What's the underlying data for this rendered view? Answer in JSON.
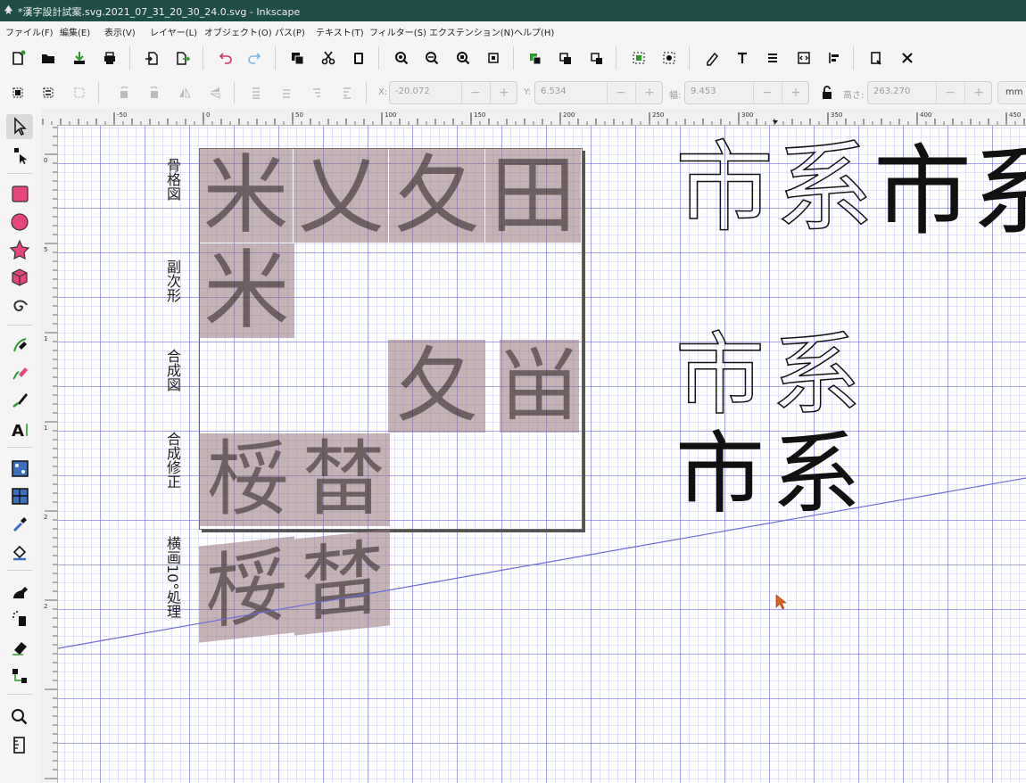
{
  "window": {
    "title": "*漢字設計試案.svg.2021_07_31_20_30_24.0.svg - Inkscape"
  },
  "menu": [
    "ファイル(F)",
    "編集(E)",
    "表示(V)",
    "レイヤー(L)",
    "オブジェクト(O)",
    "パス(P)",
    "テキスト(T)",
    "フィルター(S)",
    "エクステンション(N)",
    "ヘルプ(H)"
  ],
  "controls": {
    "x_label": "X:",
    "x_value": "-20.072",
    "y_label": "Y:",
    "y_value": "6.534",
    "w_label": "幅:",
    "w_value": "9.453",
    "h_label": "高さ:",
    "h_value": "263.270",
    "unit": "mm",
    "minus": "−",
    "plus": "+"
  },
  "ruler": {
    "top_labels": [
      "-50",
      "0",
      "50",
      "100",
      "150",
      "200",
      "250",
      "300",
      "350",
      "400",
      "450"
    ],
    "left_labels": [
      "0",
      "5",
      "1",
      "1",
      "2",
      "2"
    ]
  },
  "canvas": {
    "row_labels": [
      "骨格図",
      "副次形",
      "合成図",
      "合成修正",
      "横画10°処理"
    ],
    "skeleton_glyphs": [
      "米",
      "乂",
      "夂",
      "田"
    ],
    "sub_glyph": "米",
    "composite_glyphs": [
      "夂",
      "畄"
    ],
    "fixed_glyphs": [
      "桵",
      "榃"
    ],
    "slanted_glyphs": [
      "桵",
      "榃"
    ],
    "big_glyphs": [
      "市",
      "系"
    ]
  }
}
